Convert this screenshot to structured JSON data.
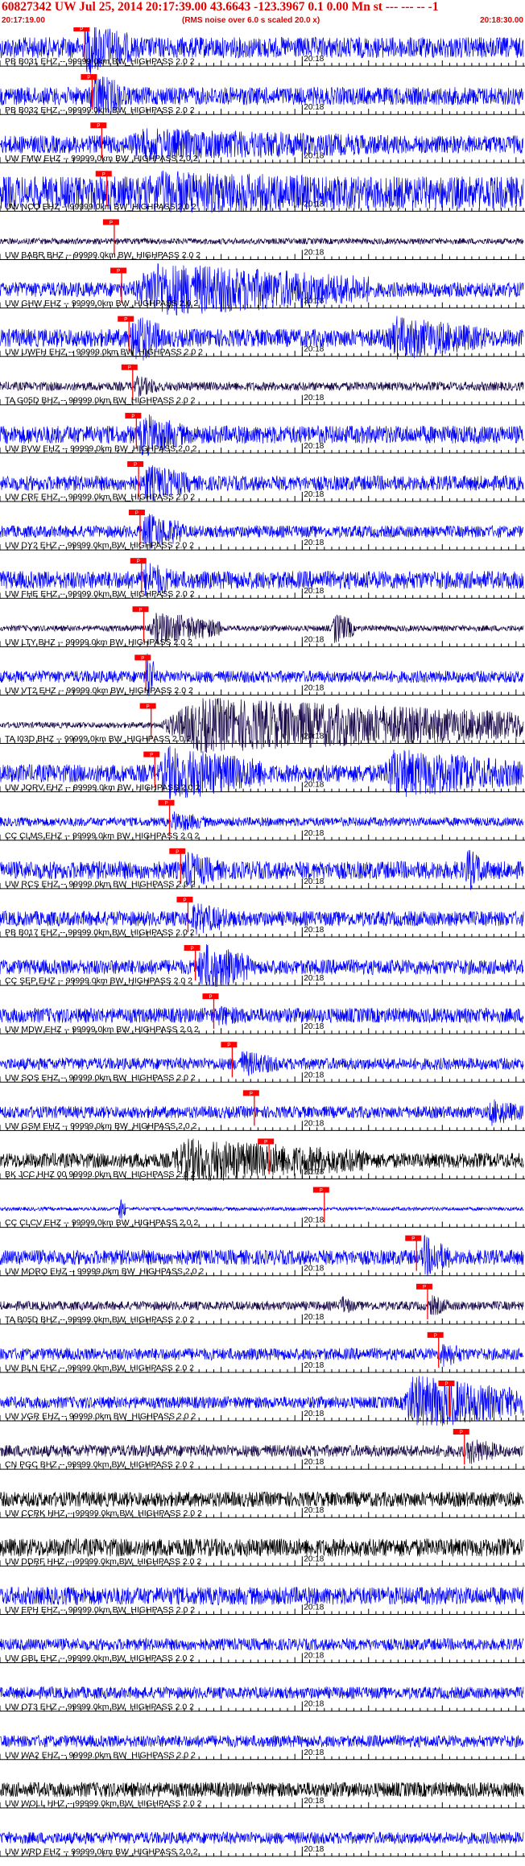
{
  "header": {
    "title": "60827342 UW Jul 25, 2014 20:17:39.00   43.6643 -123.3967  0.1 0.00 Mn st --- --- -- -1",
    "start_time": "20:17:19.00",
    "rms_note": "(RMS noise over 6.0 s scaled 20.0 x)",
    "end_time": "20:18:30.00"
  },
  "colors": {
    "trace_blue": "#0000ff",
    "trace_dark": "#1a0a4a",
    "trace_black": "#000000",
    "pick_red": "#ff0000",
    "header_red": "#e00000",
    "axis": "#000000"
  },
  "chart_data": {
    "type": "line",
    "title": "60827342 UW Jul 25, 2014 20:17:39.00",
    "time_start": "20:17:19.00",
    "time_end": "20:18:30.00",
    "minute_label": "20:18",
    "pick_label": "P",
    "xlim_seconds": [
      0,
      71
    ],
    "channels": [
      {
        "name": "PB B031 EHZ -- 99999.0km BW_HIGHPASS  2.0  2",
        "color": "blue",
        "pick_s": 11.5,
        "amp": 0.35,
        "burst": [
          [
            11,
            18,
            1.0
          ]
        ]
      },
      {
        "name": "PB B032 EHZ -- 99999.0km BW_HIGHPASS  2.0  2",
        "color": "blue",
        "pick_s": 12.5,
        "amp": 0.3,
        "burst": [
          [
            12,
            17,
            0.9
          ]
        ]
      },
      {
        "name": "UW FMW EHZ -- 99999.0km BW_HIGHPASS  2.0  2",
        "color": "blue",
        "pick_s": 13.8,
        "amp": 0.3,
        "burst": [
          [
            14,
            60,
            0.6
          ]
        ]
      },
      {
        "name": "UW NCO EHZ -- 99999.0km BW_HIGHPASS  2.0  2",
        "color": "blue",
        "pick_s": 14.5,
        "amp": 0.55,
        "burst": [
          [
            15,
            70,
            0.8
          ]
        ]
      },
      {
        "name": "UW BABR BHZ -- 99999.0km BW_HIGHPASS  2.0  2",
        "color": "dark",
        "pick_s": 15.5,
        "amp": 0.1,
        "burst": []
      },
      {
        "name": "UW GHW EHZ -- 99999.0km BW_HIGHPASS  2.0  2",
        "color": "blue",
        "pick_s": 16.5,
        "amp": 0.25,
        "burst": [
          [
            17,
            50,
            1.0
          ]
        ]
      },
      {
        "name": "UW UWFH EHZ -- 99999.0km BW_HIGHPASS  2.0  2",
        "color": "blue",
        "pick_s": 17.5,
        "amp": 0.3,
        "burst": [
          [
            17.5,
            22,
            1.0
          ],
          [
            52,
            66,
            0.8
          ]
        ]
      },
      {
        "name": "TA G05D BHZ -- 99999.0km BW_HIGHPASS  2.0  2",
        "color": "dark",
        "pick_s": 18.0,
        "amp": 0.15,
        "burst": [
          [
            18,
            22,
            0.4
          ]
        ]
      },
      {
        "name": "UW BVW EHZ -- 99999.0km BW_HIGHPASS  2.0  2",
        "color": "blue",
        "pick_s": 18.5,
        "amp": 0.3,
        "burst": [
          [
            18.5,
            25,
            0.8
          ]
        ]
      },
      {
        "name": "UW CRF EHZ -- 99999.0km BW_HIGHPASS  2.0  2",
        "color": "blue",
        "pick_s": 18.8,
        "amp": 0.25,
        "burst": [
          [
            19,
            26,
            0.7
          ]
        ]
      },
      {
        "name": "UW DY2 EHZ -- 99999.0km BW_HIGHPASS  2.0  2",
        "color": "blue",
        "pick_s": 19.0,
        "amp": 0.2,
        "burst": [
          [
            19,
            25,
            0.7
          ]
        ]
      },
      {
        "name": "UW FHE EHZ -- 99999.0km BW_HIGHPASS  2.0  2",
        "color": "blue",
        "pick_s": 19.2,
        "amp": 0.3,
        "burst": [
          [
            19.2,
            24,
            0.7
          ]
        ]
      },
      {
        "name": "UW LTY BHZ -- 99999.0km BW_HIGHPASS  2.0  2",
        "color": "dark",
        "pick_s": 19.5,
        "amp": 0.1,
        "burst": [
          [
            20,
            30,
            0.6
          ],
          [
            45,
            48,
            0.6
          ]
        ]
      },
      {
        "name": "UW VT2 EHZ -- 99999.0km BW_HIGHPASS  2.0  2",
        "color": "blue",
        "pick_s": 19.8,
        "amp": 0.2,
        "burst": [
          [
            19.8,
            21,
            1.0
          ]
        ]
      },
      {
        "name": "TA I03D BHZ -- 99999.0km BW_HIGHPASS  2.0  2",
        "color": "dark",
        "pick_s": 20.5,
        "amp": 0.1,
        "burst": [
          [
            21,
            71,
            1.0
          ]
        ]
      },
      {
        "name": "UW JORV EHZ -- 99999.0km BW_HIGHPASS  2.0  2",
        "color": "blue",
        "pick_s": 21.0,
        "amp": 0.3,
        "burst": [
          [
            21,
            36,
            1.0
          ],
          [
            51,
            71,
            0.9
          ]
        ]
      },
      {
        "name": "CC CLMS EHZ -- 99999.0km BW_HIGHPASS  2.0  2",
        "color": "blue",
        "pick_s": 23.0,
        "amp": 0.15,
        "burst": [
          [
            23,
            28,
            0.4
          ]
        ]
      },
      {
        "name": "UW RCS EHZ -- 99999.0km BW_HIGHPASS  2.0  2",
        "color": "blue",
        "pick_s": 24.5,
        "amp": 0.3,
        "burst": [
          [
            24.5,
            30,
            0.7
          ],
          [
            63,
            66,
            0.8
          ]
        ]
      },
      {
        "name": "PB B017 EHZ -- 99999.0km BW_HIGHPASS  2.0  2",
        "color": "blue",
        "pick_s": 25.5,
        "amp": 0.25,
        "burst": [
          [
            25.5,
            32,
            0.6
          ]
        ]
      },
      {
        "name": "CC SEP EHZ -- 99999.0km BW_HIGHPASS  2.0  2",
        "color": "blue",
        "pick_s": 26.5,
        "amp": 0.25,
        "burst": [
          [
            26.5,
            34,
            0.9
          ]
        ]
      },
      {
        "name": "UW MDW EHZ -- 99999.0km BW_HIGHPASS  2.0  2",
        "color": "blue",
        "pick_s": 29.0,
        "amp": 0.25,
        "burst": [
          [
            29,
            35,
            0.4
          ]
        ]
      },
      {
        "name": "UW SOS EHZ -- 99999.0km BW_HIGHPASS  2.0  2",
        "color": "blue",
        "pick_s": 31.5,
        "amp": 0.2,
        "burst": [
          [
            32,
            38,
            0.5
          ]
        ]
      },
      {
        "name": "UW GSM EHZ -- 99999.0km BW_HIGHPASS  2.0  2",
        "color": "blue",
        "pick_s": 34.5,
        "amp": 0.2,
        "burst": [
          [
            66,
            71,
            0.5
          ]
        ]
      },
      {
        "name": "BK JCC HHZ 00 99999.0km BW_HIGHPASS  2.0  2",
        "color": "black",
        "pick_s": 36.5,
        "amp": 0.25,
        "burst": [
          [
            22,
            50,
            0.8
          ]
        ]
      },
      {
        "name": "CC CLCV EHZ -- 99999.0km BW_HIGHPASS  2.0  2",
        "color": "blue",
        "pick_s": 44.0,
        "amp": 0.06,
        "burst": [
          [
            16,
            17,
            0.5
          ]
        ]
      },
      {
        "name": "UW MORO EHZ -- 99999.0km BW_HIGHPASS  2.0  2",
        "color": "blue",
        "pick_s": 56.5,
        "amp": 0.25,
        "burst": [
          [
            57,
            61,
            0.8
          ]
        ]
      },
      {
        "name": "TA B05D BHZ -- 99999.0km BW_HIGHPASS  2.0  2",
        "color": "dark",
        "pick_s": 58.0,
        "amp": 0.15,
        "burst": [
          [
            46,
            48,
            0.4
          ],
          [
            58,
            61,
            0.4
          ]
        ]
      },
      {
        "name": "UW BLN EHZ -- 99999.0km BW_HIGHPASS  2.0  2",
        "color": "blue",
        "pick_s": 59.5,
        "amp": 0.2,
        "burst": [
          [
            59.5,
            63,
            0.5
          ]
        ]
      },
      {
        "name": "UW VGR EHZ -- 99999.0km BW_HIGHPASS  2.0  2",
        "color": "blue",
        "pick_s": 61.0,
        "amp": 0.2,
        "burst": [
          [
            54,
            71,
            1.0
          ]
        ]
      },
      {
        "name": "CN PGC BHZ -- 99999.0km BW_HIGHPASS  2.0  2",
        "color": "dark",
        "pick_s": 63.0,
        "amp": 0.2,
        "burst": [
          [
            63,
            68,
            0.5
          ]
        ]
      },
      {
        "name": "UW CCRK HHZ -- 99999.0km BW_HIGHPASS  2.0  2",
        "color": "black",
        "pick_s": null,
        "amp": 0.25,
        "burst": []
      },
      {
        "name": "UW DDRF HHZ -- 99999.0km BW_HIGHPASS  2.0  2",
        "color": "black",
        "pick_s": null,
        "amp": 0.3,
        "burst": []
      },
      {
        "name": "UW EPH EHZ -- 99999.0km BW_HIGHPASS  2.0  2",
        "color": "blue",
        "pick_s": null,
        "amp": 0.3,
        "burst": []
      },
      {
        "name": "UW GBL EHZ -- 99999.0km BW_HIGHPASS  2.0  2",
        "color": "blue",
        "pick_s": null,
        "amp": 0.2,
        "burst": []
      },
      {
        "name": "UW OT3 EHZ -- 99999.0km BW_HIGHPASS  2.0  2",
        "color": "blue",
        "pick_s": null,
        "amp": 0.2,
        "burst": []
      },
      {
        "name": "UW WA2 EHZ -- 99999.0km BW_HIGHPASS  2.0  2",
        "color": "blue",
        "pick_s": null,
        "amp": 0.2,
        "burst": []
      },
      {
        "name": "UW WOLL HHZ -- 99999.0km BW_HIGHPASS  2.0  2",
        "color": "black",
        "pick_s": null,
        "amp": 0.25,
        "burst": []
      },
      {
        "name": "UW WRD EHZ -- 99999.0km BW_HIGHPASS  2.0  2",
        "color": "blue",
        "pick_s": null,
        "amp": 0.2,
        "burst": []
      }
    ]
  }
}
